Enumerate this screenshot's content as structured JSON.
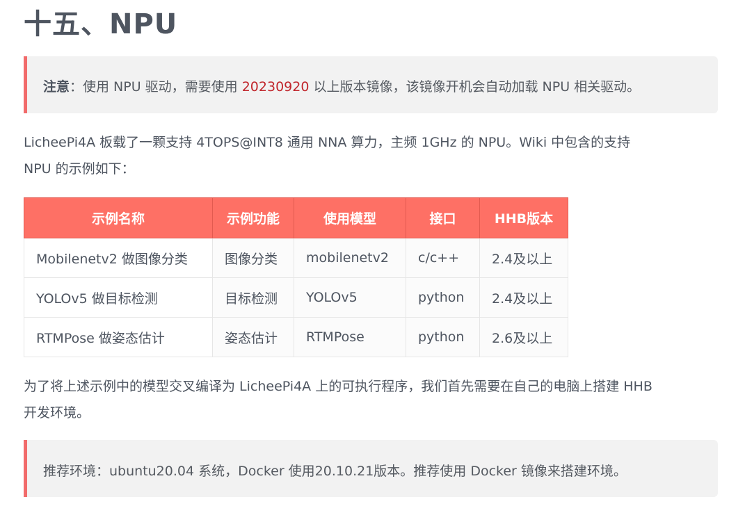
{
  "heading": "十五、NPU",
  "note1": {
    "label": "注意",
    "text_before": "：使用 NPU 驱动，需要使用 ",
    "highlight": "20230920",
    "text_after": " 以上版本镜像，该镜像开机会自动加载 NPU 相关驱动。"
  },
  "para1": {
    "line1": "LicheePi4A 板载了一颗支持 4TOPS@INT8 通用 NNA 算力，主频 1GHz 的 NPU。Wiki 中包含的支持",
    "line2": "NPU 的示例如下："
  },
  "table": {
    "headers": [
      "示例名称",
      "示例功能",
      "使用模型",
      "接口",
      "HHB版本"
    ],
    "rows": [
      [
        "Mobilenetv2 做图像分类",
        "图像分类",
        "mobilenetv2",
        "c/c++",
        "2.4及以上"
      ],
      [
        "YOLOv5 做目标检测",
        "目标检测",
        "YOLOv5",
        "python",
        "2.4及以上"
      ],
      [
        "RTMPose 做姿态估计",
        "姿态估计",
        "RTMPose",
        "python",
        "2.6及以上"
      ]
    ]
  },
  "para2": {
    "line1": "为了将上述示例中的模型交叉编译为 LicheePi4A 上的可执行程序，我们首先需要在自己的电脑上搭建 HHB",
    "line2": "开发环境。"
  },
  "note2": {
    "text": "推荐环境：ubuntu20.04 系统，Docker 使用20.10.21版本。推荐使用 Docker 镜像来搭建环境。"
  },
  "colors": {
    "accent": "#fe7065",
    "note_border": "#f16b6b",
    "highlight": "#c1272d"
  }
}
